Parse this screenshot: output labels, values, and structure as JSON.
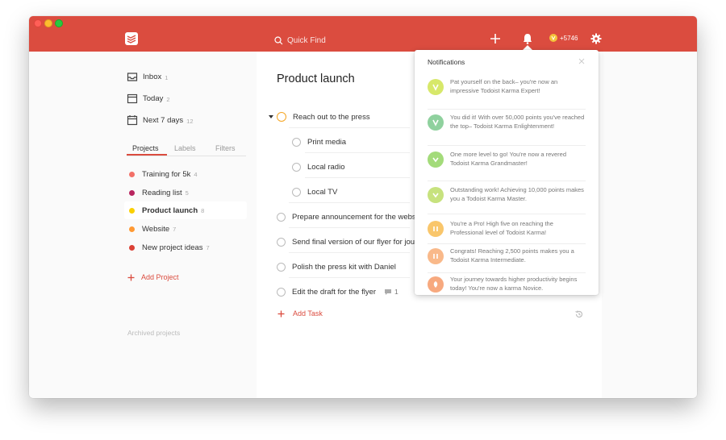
{
  "topbar": {
    "search_placeholder": "Quick Find",
    "karma_points": "+5746"
  },
  "sidebar": {
    "nav": [
      {
        "label": "Inbox",
        "count": "1"
      },
      {
        "label": "Today",
        "count": "2"
      },
      {
        "label": "Next 7 days",
        "count": "12"
      }
    ],
    "tabs": [
      "Projects",
      "Labels",
      "Filters"
    ],
    "projects": [
      {
        "label": "Training for 5k",
        "count": "4",
        "color": "#f27068"
      },
      {
        "label": "Reading list",
        "count": "5",
        "color": "#b8255f"
      },
      {
        "label": "Product launch",
        "count": "8",
        "color": "#fad000"
      },
      {
        "label": "Website",
        "count": "7",
        "color": "#ff9933"
      },
      {
        "label": "New project ideas",
        "count": "7",
        "color": "#db4035"
      }
    ],
    "add_project": "Add Project",
    "archived": "Archived projects"
  },
  "main": {
    "title": "Product launch",
    "tasks": [
      {
        "label": "Reach out to the press"
      },
      {
        "label": "Print media"
      },
      {
        "label": "Local radio"
      },
      {
        "label": "Local TV"
      },
      {
        "label": "Prepare announcement for the webs"
      },
      {
        "label": "Send final version of our flyer for jou"
      },
      {
        "label": "Polish the press kit with Daniel"
      },
      {
        "label": "Edit the draft for the flyer",
        "comments": "1"
      }
    ],
    "add_task": "Add Task"
  },
  "notifications": {
    "title": "Notifications",
    "items": [
      {
        "text": "Pat yourself on the back– you're now an impressive Todoist Karma Expert!",
        "color": "#d7e86a"
      },
      {
        "text": "You did it! With over 50,000 points you've reached the top– Todoist Karma Enlightenment!",
        "color": "#8fd19e"
      },
      {
        "text": "One more level to go! You're now a revered Todoist Karma Grandmaster!",
        "color": "#a3db7a"
      },
      {
        "text": "Outstanding work! Achieving 10,000 points makes you a Todoist Karma Master.",
        "color": "#c7e27e"
      },
      {
        "text": "You're a Pro! High five on reaching the Professional level of Todoist Karma!",
        "color": "#f9c66b"
      },
      {
        "text": "Congrats! Reaching 2,500 points makes you a Todoist Karma Intermediate.",
        "color": "#f9b98a"
      },
      {
        "text": "Your journey towards higher productivity begins today! You're now a karma Novice.",
        "color": "#f7a97f"
      }
    ]
  }
}
